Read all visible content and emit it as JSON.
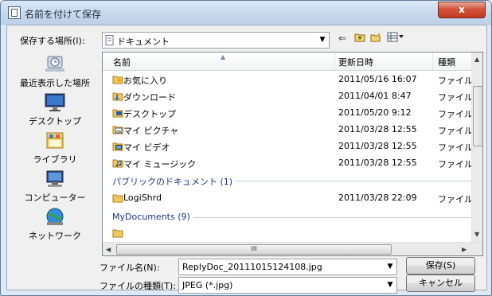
{
  "window": {
    "title": "名前を付けて保存",
    "close_label": "x"
  },
  "save_location": {
    "label": "保存する場所(I):",
    "value": "ドキュメント"
  },
  "places": [
    {
      "label": "最近表示した場所",
      "icon": "recent-places-icon"
    },
    {
      "label": "デスクトップ",
      "icon": "desktop-icon"
    },
    {
      "label": "ライブラリ",
      "icon": "library-icon"
    },
    {
      "label": "コンピューター",
      "icon": "computer-icon"
    },
    {
      "label": "ネットワーク",
      "icon": "network-icon"
    }
  ],
  "columns": {
    "name": "名前",
    "date": "更新日時",
    "type": "種類"
  },
  "files": [
    {
      "name": "お気に入り",
      "date": "2011/05/16 16:07",
      "type": "ファイル フ",
      "icon": "favorites-folder-icon"
    },
    {
      "name": "ダウンロード",
      "date": "2011/04/01 8:47",
      "type": "ファイル フ",
      "icon": "downloads-folder-icon"
    },
    {
      "name": "デスクトップ",
      "date": "2011/05/20 9:12",
      "type": "ファイル フ",
      "icon": "desktop-folder-icon"
    },
    {
      "name": "マイ ピクチャ",
      "date": "2011/03/28 12:55",
      "type": "ファイル フ",
      "icon": "pictures-folder-icon"
    },
    {
      "name": "マイ ビデオ",
      "date": "2011/03/28 12:55",
      "type": "ファイル フ",
      "icon": "videos-folder-icon"
    },
    {
      "name": "マイ ミュージック",
      "date": "2011/03/28 12:55",
      "type": "ファイル フ",
      "icon": "music-folder-icon"
    }
  ],
  "group_public": "パブリックのドキュメント (1)",
  "public_files": [
    {
      "name": "LogiShrd",
      "date": "2011/03/28 22:09",
      "type": "ファイル フ",
      "icon": "folder-icon"
    }
  ],
  "group_mydocs": "MyDocuments (9)",
  "hscroll_grip": "III",
  "filename": {
    "label": "ファイル名(N):",
    "value": "ReplyDoc_20111015124108.jpg"
  },
  "filetype": {
    "label": "ファイルの種類(T):",
    "value": "JPEG (*.jpg)"
  },
  "buttons": {
    "save": "保存(S)",
    "cancel": "キャンセル"
  },
  "colors": {
    "accent": "#1e3287",
    "title_bar": "#c6d7ec",
    "close": "#c0391f"
  }
}
